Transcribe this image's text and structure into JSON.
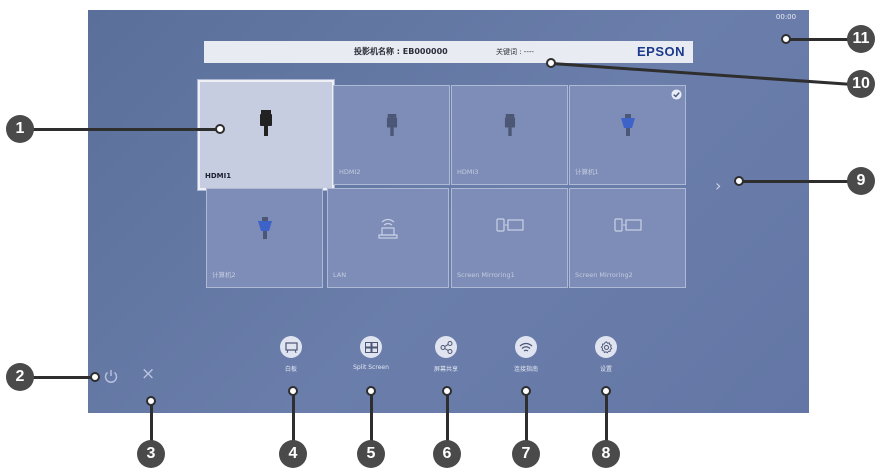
{
  "status": {
    "clock": "00:00"
  },
  "infobar": {
    "projector_name": "投影机名称 : EB000000",
    "keyword": "关键词 : ----",
    "brand": "EPSON"
  },
  "sources": [
    {
      "label": "HDMI1",
      "icon": "hdmi-plug-icon",
      "selected": true
    },
    {
      "label": "HDMI2",
      "icon": "hdmi-plug-icon"
    },
    {
      "label": "HDMI3",
      "icon": "hdmi-plug-icon"
    },
    {
      "label": "计算机1",
      "icon": "vga-connector-icon",
      "checked": true
    },
    {
      "label": "计算机2",
      "icon": "vga-connector-icon"
    },
    {
      "label": "LAN",
      "icon": "lan-network-icon"
    },
    {
      "label": "Screen Mirroring1",
      "icon": "screen-mirroring-icon"
    },
    {
      "label": "Screen Mirroring2",
      "icon": "screen-mirroring-icon"
    }
  ],
  "menu": [
    {
      "label": "白板",
      "icon": "whiteboard-icon"
    },
    {
      "label": "Split Screen",
      "icon": "split-screen-icon"
    },
    {
      "label": "屏幕共享",
      "icon": "share-icon"
    },
    {
      "label": "连接指南",
      "icon": "wifi-icon"
    },
    {
      "label": "设置",
      "icon": "settings-gear-icon"
    }
  ],
  "controls": {
    "next_arrow": "›",
    "close": "×"
  },
  "callouts": [
    "1",
    "2",
    "3",
    "4",
    "5",
    "6",
    "7",
    "8",
    "9",
    "10",
    "11"
  ],
  "colors": {
    "screen_bg": "#6577a5",
    "tile_bg": "#7e8db7",
    "selected_tile": "#c7cde0",
    "brand": "#1c3a8c",
    "accent_icon": "#3e63c8"
  }
}
